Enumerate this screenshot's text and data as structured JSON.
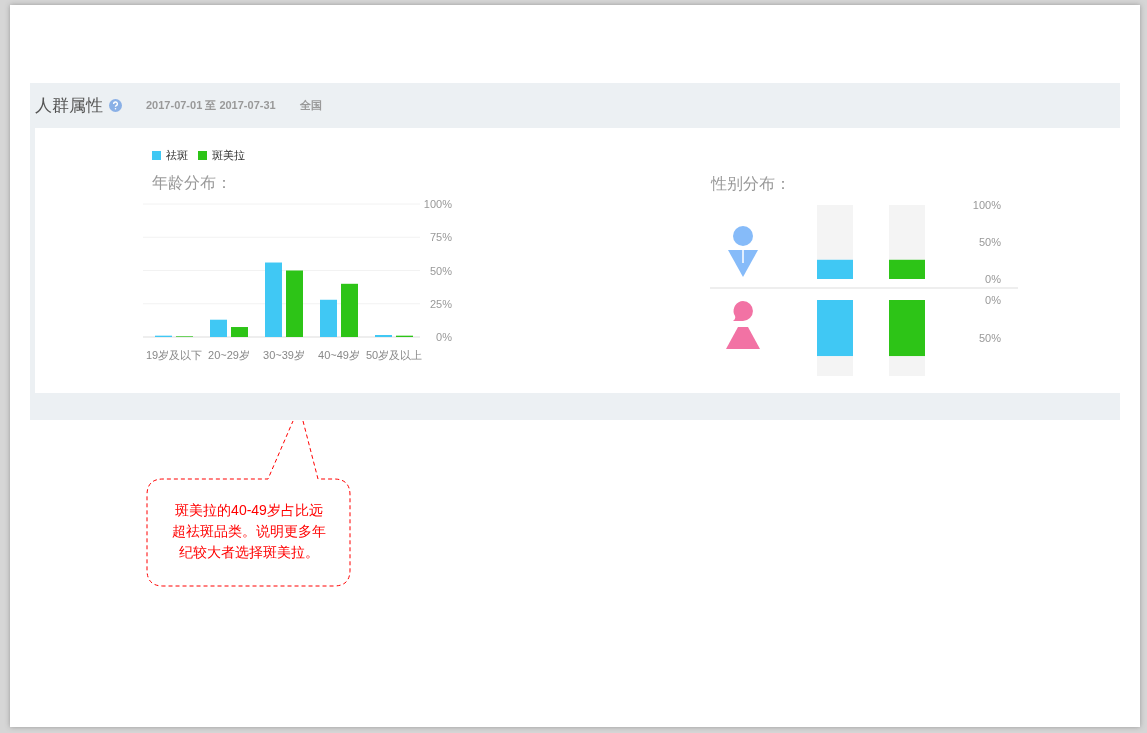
{
  "panel": {
    "title": "人群属性",
    "date_range": "2017-07-01 至 2017-07-31",
    "region": "全国"
  },
  "age": {
    "title": "年龄分布：",
    "chart_data": {
      "type": "bar",
      "grid": true,
      "legend": "top",
      "categories": [
        "19岁及以下",
        "20~29岁",
        "30~39岁",
        "40~49岁",
        "50岁及以上"
      ],
      "series": [
        {
          "name": "祛斑",
          "color": "#40c8f4",
          "values": [
            1,
            13,
            56,
            28,
            1.5
          ]
        },
        {
          "name": "斑美拉",
          "color": "#2dc417",
          "values": [
            0.5,
            7.5,
            50,
            40,
            1
          ]
        }
      ],
      "ylim": [
        0,
        100
      ],
      "yticks": [
        {
          "value": 0,
          "label": "0%"
        },
        {
          "value": 25,
          "label": "25%"
        },
        {
          "value": 50,
          "label": "50%"
        },
        {
          "value": 75,
          "label": "75%"
        },
        {
          "value": 100,
          "label": "100%"
        }
      ]
    }
  },
  "gender": {
    "title": "性别分布：",
    "rows": [
      {
        "kind": "male",
        "ticks": [
          "100%",
          "50%",
          "0%"
        ],
        "bars": [
          {
            "level": 0.26
          },
          {
            "level": 0.26
          }
        ]
      },
      {
        "kind": "female",
        "ticks": [
          "0%",
          "50%"
        ],
        "bars": [
          {
            "level": 0.74
          },
          {
            "level": 0.74
          }
        ]
      }
    ]
  },
  "callout": {
    "text": "斑美拉的40-49岁占比远超祛斑品类。说明更多年纪较大者选择斑美拉。"
  }
}
